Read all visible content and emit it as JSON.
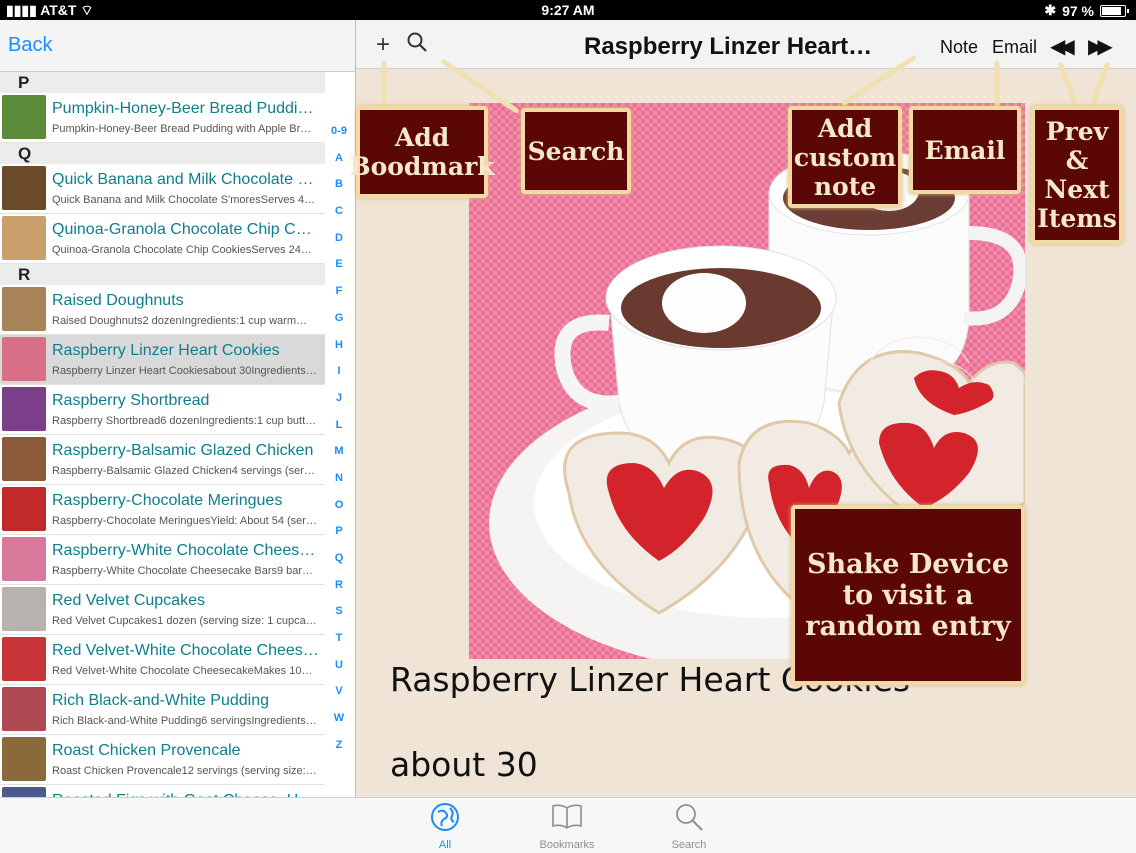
{
  "status": {
    "carrier": "AT&T",
    "time": "9:27 AM",
    "battery": "97 %",
    "battery_level": 0.97
  },
  "left": {
    "back_label": "Back",
    "sections": [
      {
        "letter": "P",
        "items": [
          {
            "title": "Pumpkin-Honey-Beer Bread Puddin…",
            "subtitle": "Pumpkin-Honey-Beer Bread Pudding with Apple Br…",
            "thumb": "#5b8a3a"
          }
        ]
      },
      {
        "letter": "Q",
        "items": [
          {
            "title": "Quick Banana and Milk Chocolate S'…",
            "subtitle": "Quick Banana and Milk Chocolate S'moresServes 4…",
            "thumb": "#6b4a2a"
          },
          {
            "title": "Quinoa-Granola Chocolate Chip Co…",
            "subtitle": "Quinoa-Granola Chocolate Chip CookiesServes 24…",
            "thumb": "#c9a06b"
          }
        ]
      },
      {
        "letter": "R",
        "items": [
          {
            "title": "Raised Doughnuts",
            "subtitle": "Raised Doughnuts2 dozenIngredients:1 cup warm…",
            "thumb": "#a8835a"
          },
          {
            "title": "Raspberry Linzer Heart Cookies",
            "subtitle": "Raspberry Linzer Heart Cookiesabout 30Ingredients…",
            "thumb": "#d96f86",
            "selected": true
          },
          {
            "title": "Raspberry Shortbread",
            "subtitle": "Raspberry Shortbread6 dozenIngredients:1 cup butt…",
            "thumb": "#7a3e8a"
          },
          {
            "title": "Raspberry-Balsamic Glazed Chicken",
            "subtitle": "Raspberry-Balsamic Glazed Chicken4 servings (ser…",
            "thumb": "#8a5a3a"
          },
          {
            "title": "Raspberry-Chocolate Meringues",
            "subtitle": "Raspberry-Chocolate MeringuesYield: About 54 (ser…",
            "thumb": "#c22a2a"
          },
          {
            "title": "Raspberry-White Chocolate Cheese…",
            "subtitle": "Raspberry-White Chocolate Cheesecake Bars9 bar…",
            "thumb": "#d77a9c"
          },
          {
            "title": "Red Velvet Cupcakes",
            "subtitle": "Red Velvet Cupcakes1 dozen (serving size: 1 cupca…",
            "thumb": "#b8b2ae"
          },
          {
            "title": "Red Velvet-White Chocolate Chees…",
            "subtitle": "Red Velvet-White Chocolate CheesecakeMakes 10…",
            "thumb": "#c9363a"
          },
          {
            "title": "Rich Black-and-White Pudding",
            "subtitle": "Rich Black-and-White Pudding6 servingsIngredients…",
            "thumb": "#b04a52"
          },
          {
            "title": "Roast Chicken Provencale",
            "subtitle": "Roast Chicken Provencale12 servings (serving size:…",
            "thumb": "#8a6a3a"
          },
          {
            "title": "Roasted Figs with Goat Cheese, Ho…",
            "subtitle": "",
            "thumb": "#4a5a8a"
          }
        ]
      }
    ],
    "index": [
      "0-9",
      "A",
      "B",
      "C",
      "D",
      "E",
      "F",
      "G",
      "H",
      "I",
      "J",
      "L",
      "M",
      "N",
      "O",
      "P",
      "Q",
      "R",
      "S",
      "T",
      "U",
      "V",
      "W",
      "Z"
    ]
  },
  "right": {
    "title": "Raspberry Linzer Heart…",
    "note_label": "Note",
    "email_label": "Email",
    "body_title": "Raspberry Linzer Heart Cookies",
    "body_yield": "about 30"
  },
  "callouts": {
    "add_bookmark": "Add Boodmark",
    "search": "Search",
    "custom_note": "Add custom note",
    "email": "Email",
    "prev_next": "Prev & Next Items",
    "shake": "Shake Device to visit a random entry"
  },
  "tabs": [
    {
      "label": "All",
      "icon": "globe-icon",
      "active": true
    },
    {
      "label": "Bookmarks",
      "icon": "book-icon",
      "active": false
    },
    {
      "label": "Search",
      "icon": "magnifier-icon",
      "active": false
    }
  ],
  "colors": {
    "accent": "#1a8cff",
    "link": "#0e7e8c",
    "callout_bg": "#5b0708",
    "callout_text": "#f4e8c9",
    "page_bg": "#efe4d6"
  }
}
